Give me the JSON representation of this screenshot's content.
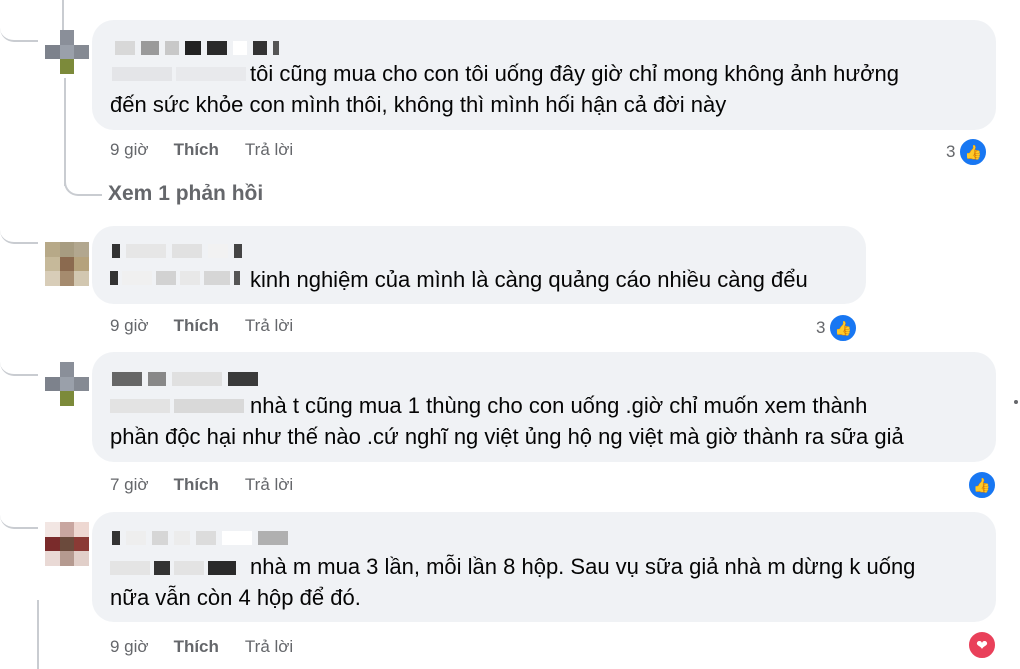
{
  "comments": [
    {
      "text_lines": [
        "tôi cũng mua cho con tôi uống đây giờ chỉ mong không ảnh hưởng",
        "đến sức khỏe con mình thôi, không thì mình hối hận cả đời này"
      ],
      "time": "9 giờ",
      "like_label": "Thích",
      "reply_label": "Trả lời",
      "reaction_count": "3",
      "reaction_icon": "like-icon"
    },
    {
      "text_lines": [
        "kinh nghiệm của mình là càng quảng cáo nhiều càng đểu"
      ],
      "time": "9 giờ",
      "like_label": "Thích",
      "reply_label": "Trả lời",
      "reaction_count": "3",
      "reaction_icon": "like-icon"
    },
    {
      "text_lines": [
        "nhà t cũng mua 1 thùng cho con uống .giờ chỉ muốn xem thành",
        "phần độc hại như thế nào .cứ nghĩ ng việt ủng hộ ng việt mà giờ thành ra sữa giả"
      ],
      "time": "7 giờ",
      "like_label": "Thích",
      "reply_label": "Trả lời",
      "reaction_count": "",
      "reaction_icon": "like-icon"
    },
    {
      "text_lines": [
        "nhà m mua 3 lần, mỗi lần 8 hộp. Sau vụ sữa giả nhà m dừng k uống",
        "nữa vẫn còn 4 hộp để đó."
      ],
      "time": "9 giờ",
      "like_label": "Thích",
      "reply_label": "Trả lời",
      "reaction_count": "",
      "reaction_icon": "heart-icon"
    }
  ],
  "view_replies_label": "Xem 1 phản hồi",
  "colors": {
    "bubble": "#f0f2f5",
    "meta_text": "#65676b",
    "like_blue": "#1877f2",
    "love_red": "#e9405a"
  }
}
